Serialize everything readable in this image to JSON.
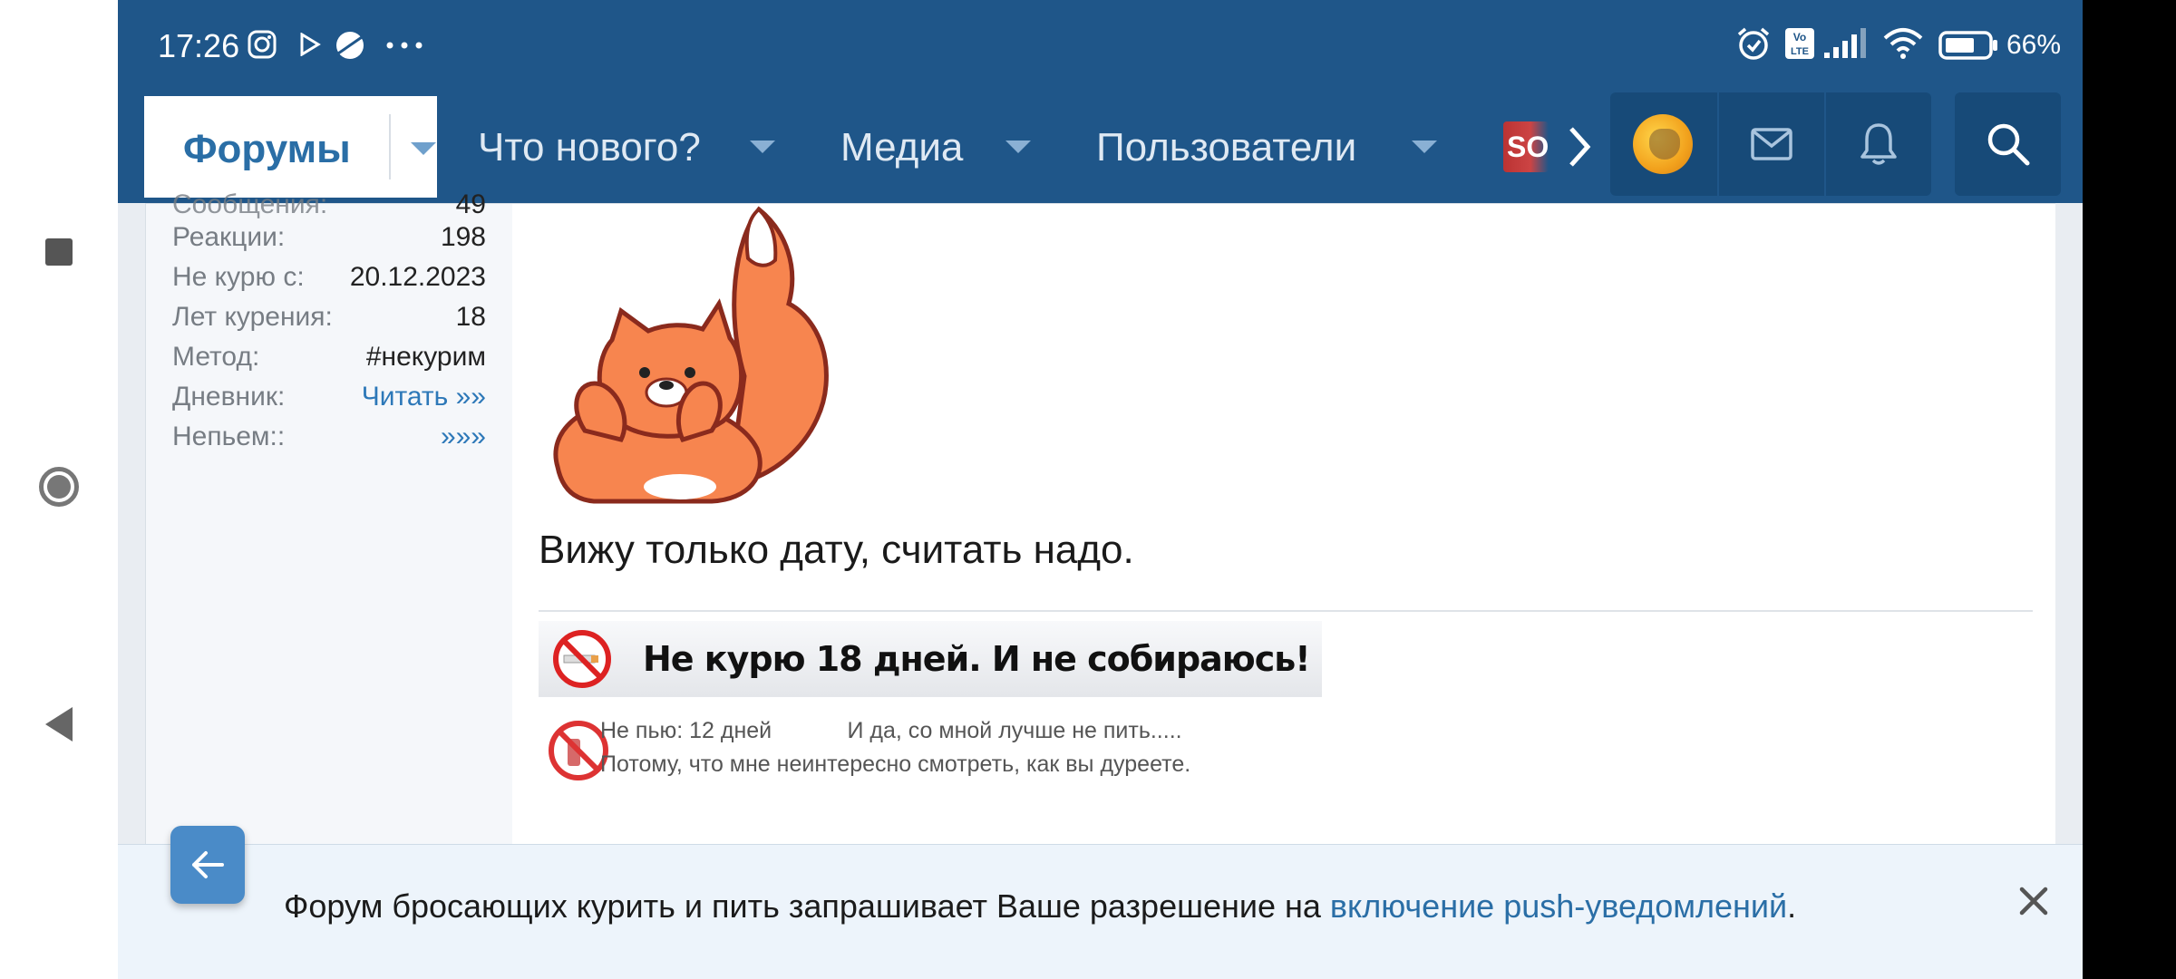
{
  "status_bar": {
    "time": "17:26",
    "battery": "66%"
  },
  "nav": {
    "forums": "Форумы",
    "whats_new": "Что нового?",
    "media": "Медиа",
    "users": "Пользователи",
    "more_abbrev": "SO"
  },
  "user_info": [
    {
      "key": "Реакции:",
      "value": "198"
    },
    {
      "key": "Не курю с:",
      "value": "20.12.2023"
    },
    {
      "key": "Лет курения:",
      "value": "18"
    },
    {
      "key": "Метод:",
      "value": "#некурим"
    },
    {
      "key": "Дневник:",
      "value": "Читать »»"
    },
    {
      "key": "Непьем::",
      "value": "»»»"
    }
  ],
  "post": {
    "text": "Вижу только дату, считать надо."
  },
  "signature": {
    "banner": "Не курю 18 дней. И не собираюсь!",
    "line1": "Не пью: 12 дней            И да, со мной лучше не пить.....",
    "line2": "Потому, что мне неинтересно смотреть, как вы дуреете."
  },
  "push_bar": {
    "text_before": "Форум бросающих курить и пить запрашивает Ваше разрешение на ",
    "link": "включение push-уведомлений",
    "text_after": "."
  },
  "colors": {
    "header": "#1f5689",
    "accent": "#2a6ea6",
    "push_bg": "#edf4fb"
  }
}
